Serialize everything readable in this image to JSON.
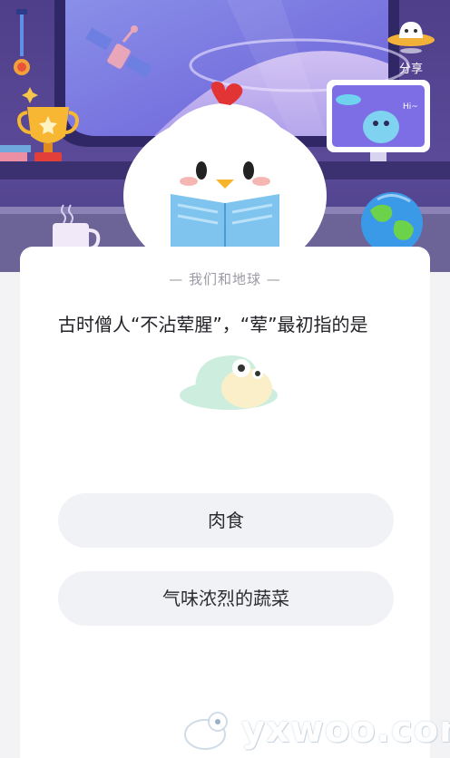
{
  "header": {
    "share_label": "分享",
    "monitor_text": "Hi~"
  },
  "quiz": {
    "category": "— 我们和地球 —",
    "question": "古时僧人“不沾荤腥”，“荤”最初指的是",
    "options": [
      {
        "label": "肉食"
      },
      {
        "label": "气味浓烈的蔬菜"
      }
    ]
  },
  "watermark": {
    "text": "yxwoo.com"
  },
  "colors": {
    "header_bg": "#4f3f8a",
    "card_bg": "#ffffff",
    "option_bg": "#f1f2f6",
    "text": "#222228",
    "subtitle": "#9a9aa4"
  }
}
